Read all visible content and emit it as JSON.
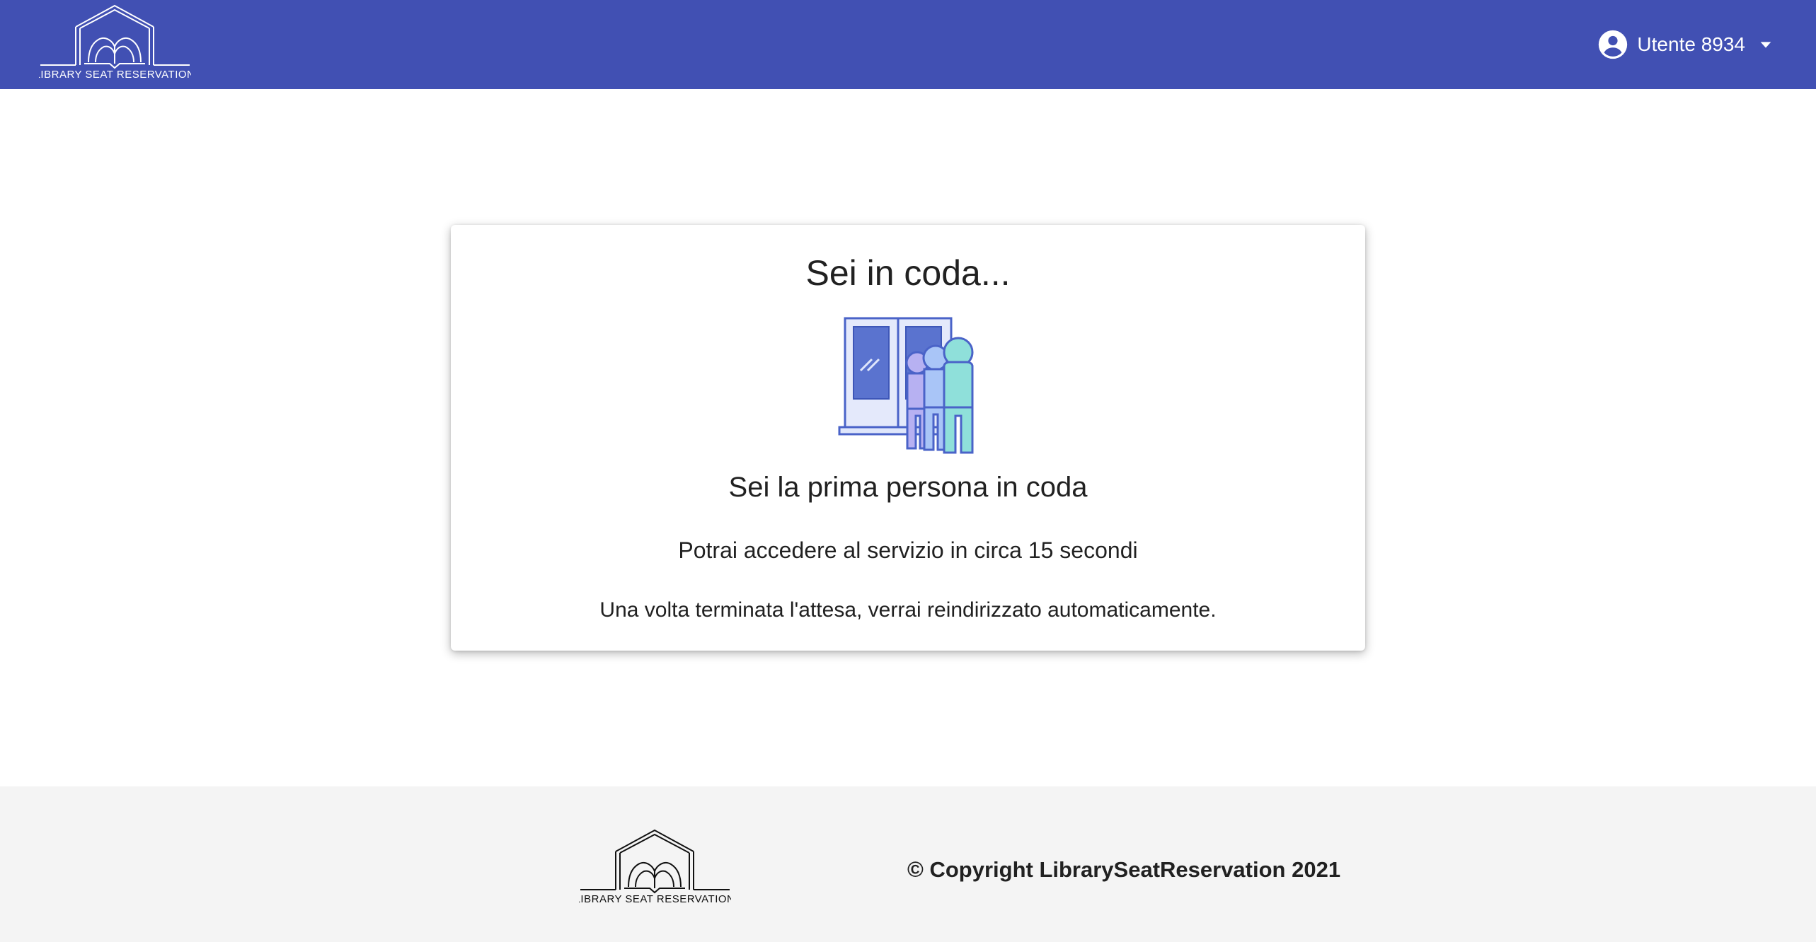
{
  "header": {
    "logo_text": "LIBRARY SEAT RESERVATION",
    "user": {
      "name": "Utente 8934",
      "avatar_icon": "account-circle-icon",
      "menu_icon": "caret-down-icon"
    },
    "background_color": "#4150b3"
  },
  "queue": {
    "title": "Sei in coda...",
    "illustration": "queue-people-door-illustration",
    "position_text": "Sei la prima persona in coda",
    "wait_text": "Potrai accedere al servizio in circa 15 secondi",
    "redirect_text": "Una volta terminata l'attesa, verrai reindirizzato automaticamente."
  },
  "footer": {
    "logo_text": "LIBRARY SEAT RESERVATION",
    "copyright": "© Copyright LibrarySeatReservation 2021",
    "background_color": "#f4f4f4"
  }
}
